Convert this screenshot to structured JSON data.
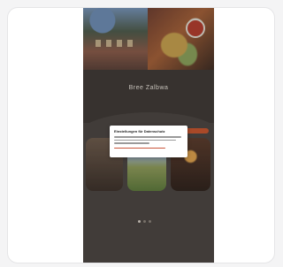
{
  "page": {
    "site_title": "Bree Zalbwa",
    "site_subtitle": "",
    "section_label": "",
    "cookie_modal": {
      "title": "Einstellungen für Datenschutz"
    },
    "tiles": [
      {
        "caption": ""
      },
      {
        "caption": ""
      },
      {
        "caption": ""
      }
    ],
    "footer_text": ""
  },
  "colors": {
    "accent": "#c8542d",
    "background": "#4a4441",
    "modal": "#ffffff"
  }
}
